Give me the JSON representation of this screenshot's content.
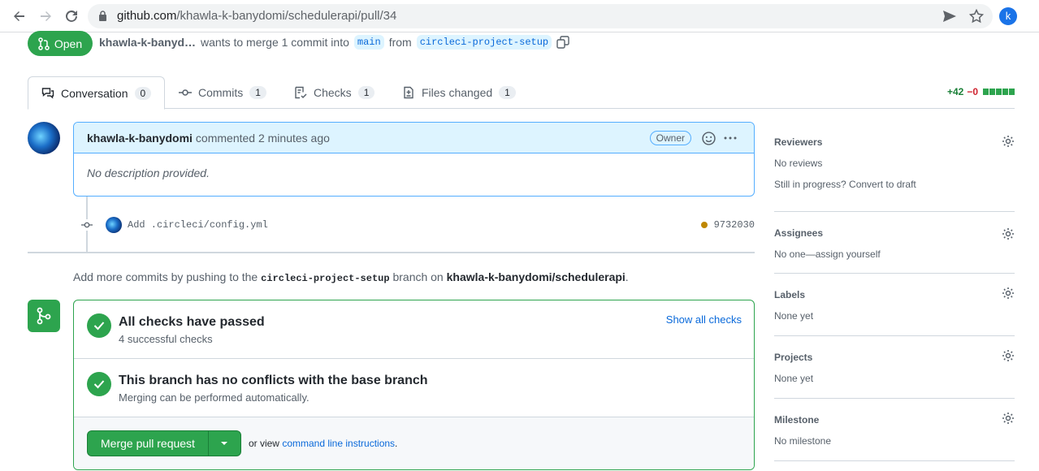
{
  "browser": {
    "url_host": "github.com",
    "url_path": "/khawla-k-banydomi/schedulerapi/pull/34",
    "profile_initial": "k"
  },
  "pr": {
    "state": "Open",
    "author_short": "khawla-k-banyd…",
    "merge_text": "wants to merge 1 commit into",
    "base_branch": "main",
    "from_text": "from",
    "head_branch": "circleci-project-setup"
  },
  "tabs": [
    {
      "label": "Conversation",
      "count": "0"
    },
    {
      "label": "Commits",
      "count": "1"
    },
    {
      "label": "Checks",
      "count": "1"
    },
    {
      "label": "Files changed",
      "count": "1"
    }
  ],
  "diffstat": {
    "additions": "+42",
    "deletions": "−0"
  },
  "comment": {
    "author": "khawla-k-banydomi",
    "action": "commented 2 minutes ago",
    "badge": "Owner",
    "body": "No description provided."
  },
  "commit": {
    "message": "Add .circleci/config.yml",
    "sha": "9732030"
  },
  "push_note": {
    "prefix": "Add more commits by pushing to the",
    "branch": "circleci-project-setup",
    "middle": "branch on",
    "repo": "khawla-k-banydomi/schedulerapi",
    "suffix": "."
  },
  "merge": {
    "checks_title": "All checks have passed",
    "checks_sub": "4 successful checks",
    "show_all": "Show all checks",
    "conflicts_title": "This branch has no conflicts with the base branch",
    "conflicts_sub": "Merging can be performed automatically.",
    "button": "Merge pull request",
    "or_view": "or view",
    "cli_link": "command line instructions",
    "cli_suffix": "."
  },
  "sidebar": {
    "reviewers": {
      "title": "Reviewers",
      "value": "No reviews",
      "extra": "Still in progress? Convert to draft"
    },
    "assignees": {
      "title": "Assignees",
      "value": "No one—assign yourself"
    },
    "labels": {
      "title": "Labels",
      "value": "None yet"
    },
    "projects": {
      "title": "Projects",
      "value": "None yet"
    },
    "milestone": {
      "title": "Milestone",
      "value": "No milestone"
    }
  },
  "colors": {
    "accent_green": "#2da44e",
    "link_blue": "#0969da",
    "comment_head": "#ddf4ff"
  }
}
